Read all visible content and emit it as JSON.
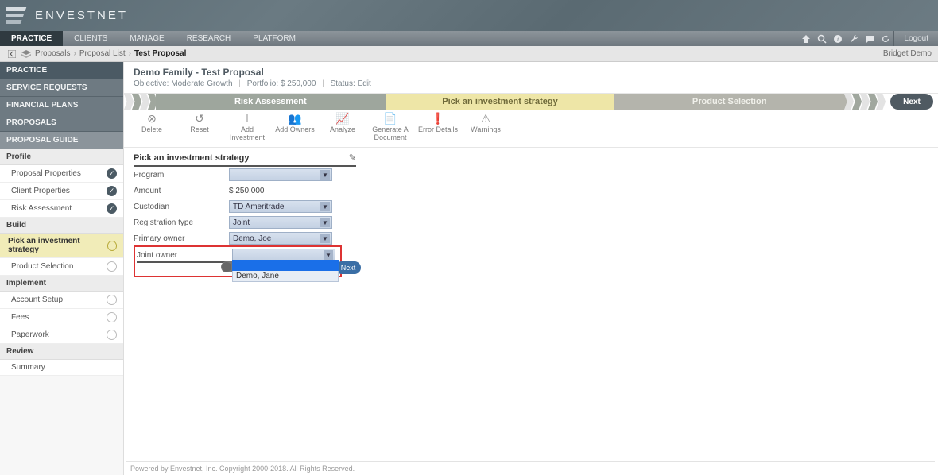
{
  "brand": "ENVESTNET",
  "primary_nav": {
    "tabs": [
      "PRACTICE",
      "CLIENTS",
      "MANAGE",
      "RESEARCH",
      "PLATFORM"
    ],
    "logout": "Logout"
  },
  "breadcrumb": {
    "items": [
      "Proposals",
      "Proposal List",
      "Test Proposal"
    ],
    "user": "Bridget Demo"
  },
  "left_nav": {
    "top": [
      "PRACTICE",
      "SERVICE REQUESTS",
      "FINANCIAL PLANS",
      "PROPOSALS",
      "PROPOSAL GUIDE"
    ],
    "profile_head": "Profile",
    "profile": [
      "Proposal Properties",
      "Client Properties",
      "Risk Assessment"
    ],
    "build_head": "Build",
    "build": [
      "Pick an investment strategy",
      "Product Selection"
    ],
    "implement_head": "Implement",
    "implement": [
      "Account Setup",
      "Fees",
      "Paperwork"
    ],
    "review_head": "Review",
    "review": [
      "Summary"
    ]
  },
  "page": {
    "title": "Demo Family - Test Proposal",
    "objective_label": "Objective:",
    "objective": "Moderate Growth",
    "portfolio_label": "Portfolio:",
    "portfolio": "$ 250,000",
    "status_label": "Status:",
    "status": "Edit"
  },
  "steps": [
    "Risk Assessment",
    "Pick an investment strategy",
    "Product Selection"
  ],
  "next_label": "Next",
  "toolbar": [
    {
      "label": "Delete"
    },
    {
      "label": "Reset"
    },
    {
      "label": "Add Investment"
    },
    {
      "label": "Add Owners"
    },
    {
      "label": "Analyze"
    },
    {
      "label": "Generate A Document"
    },
    {
      "label": "Error Details"
    },
    {
      "label": "Warnings"
    }
  ],
  "form": {
    "title": "Pick an investment strategy",
    "program_label": "Program",
    "program_value": "",
    "amount_label": "Amount",
    "amount_value": "$ 250,000",
    "custodian_label": "Custodian",
    "custodian_value": "TD Ameritrade",
    "reg_label": "Registration type",
    "reg_value": "Joint",
    "primary_label": "Primary owner",
    "primary_value": "Demo, Joe",
    "joint_label": "Joint owner",
    "joint_value": "",
    "joint_option": "Demo, Jane",
    "small_next": "Next"
  },
  "footer": "Powered by Envestnet, Inc. Copyright 2000-2018. All Rights Reserved."
}
